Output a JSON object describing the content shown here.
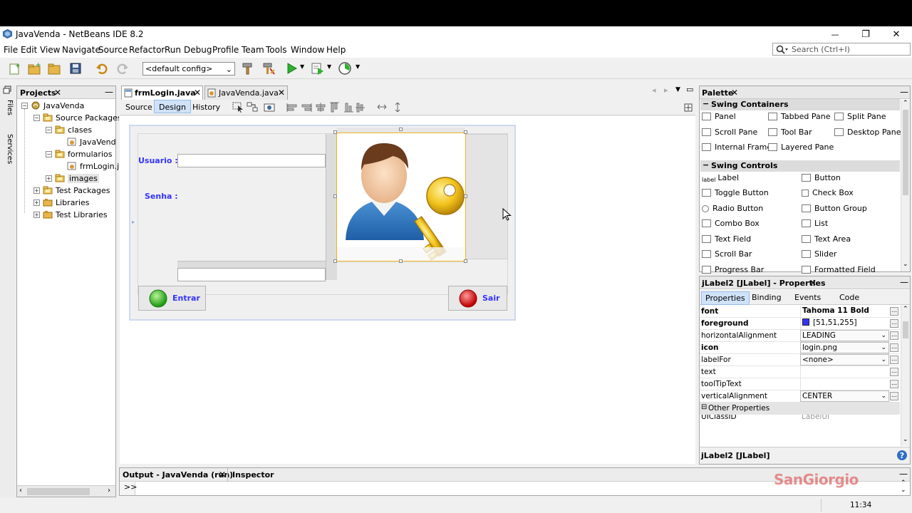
{
  "window": {
    "title": "JavaVenda - NetBeans IDE 8.2",
    "minimize": "—",
    "maximize": "❐",
    "close": "✕"
  },
  "menu": [
    "File",
    "Edit",
    "View",
    "Navigate",
    "Source",
    "Refactor",
    "Run",
    "Debug",
    "Profile",
    "Team",
    "Tools",
    "Window",
    "Help"
  ],
  "search": {
    "placeholder": "Search (Ctrl+I)"
  },
  "toolbar": {
    "config": "<default config>"
  },
  "side_strip": [
    "Files",
    "Services"
  ],
  "projects": {
    "title": "Projects",
    "tree": [
      {
        "label": "JavaVenda",
        "depth": 0,
        "exp": "−"
      },
      {
        "label": "Source Packages",
        "depth": 1,
        "exp": "−"
      },
      {
        "label": "clases",
        "depth": 2,
        "exp": "−"
      },
      {
        "label": "JavaVend",
        "depth": 3,
        "exp": ""
      },
      {
        "label": "formularios",
        "depth": 2,
        "exp": "−"
      },
      {
        "label": "frmLogin.j",
        "depth": 3,
        "exp": ""
      },
      {
        "label": "images",
        "depth": 2,
        "exp": "+"
      },
      {
        "label": "Test Packages",
        "depth": 1,
        "exp": "+"
      },
      {
        "label": "Libraries",
        "depth": 1,
        "exp": "+"
      },
      {
        "label": "Test Libraries",
        "depth": 1,
        "exp": "+"
      }
    ]
  },
  "editor": {
    "tabs": [
      {
        "label": "frmLogin.java",
        "active": true
      },
      {
        "label": "JavaVenda.java",
        "active": false
      }
    ],
    "views": [
      "Source",
      "Design",
      "History"
    ],
    "active_view": "Design"
  },
  "form": {
    "usuario_label": "Usuario :",
    "senha_label": "Senha :",
    "entrar_label": "Entrar",
    "sair_label": "Sair"
  },
  "palette": {
    "title": "Palette",
    "categories": [
      {
        "name": "Swing Containers",
        "items": [
          "Panel",
          "Tabbed Pane",
          "Split Pane",
          "Scroll Pane",
          "Tool Bar",
          "Desktop Pane",
          "Internal Frame",
          "Layered Pane"
        ]
      },
      {
        "name": "Swing Controls",
        "items": [
          "Label",
          "Button",
          "Toggle Button",
          "Check Box",
          "Radio Button",
          "Button Group",
          "Combo Box",
          "List",
          "Text Field",
          "Text Area",
          "Scroll Bar",
          "Slider",
          "Progress Bar",
          "Formatted Field"
        ]
      }
    ],
    "label_icon_text": "label"
  },
  "properties": {
    "title": "jLabel2 [JLabel] - Properties",
    "tabs": [
      "Properties",
      "Binding",
      "Events",
      "Code"
    ],
    "rows": [
      {
        "name": "font",
        "value": "Tahoma 11 Bold",
        "bold": true,
        "dropdown": false
      },
      {
        "name": "foreground",
        "value": "[51,51,255]",
        "bold": true,
        "dropdown": false,
        "swatch": "#3333ff"
      },
      {
        "name": "horizontalAlignment",
        "value": "LEADING",
        "bold": false,
        "dropdown": true
      },
      {
        "name": "icon",
        "value": "login.png",
        "bold": true,
        "dropdown": true
      },
      {
        "name": "labelFor",
        "value": "<none>",
        "bold": false,
        "dropdown": true
      },
      {
        "name": "text",
        "value": "",
        "bold": false,
        "dropdown": false
      },
      {
        "name": "toolTipText",
        "value": "",
        "bold": false,
        "dropdown": false
      },
      {
        "name": "verticalAlignment",
        "value": "CENTER",
        "bold": false,
        "dropdown": true
      }
    ],
    "other_header": "Other Properties",
    "partial_row": {
      "name": "UIClassID",
      "value": "LabelUI"
    },
    "footer": "jLabel2 [JLabel]"
  },
  "output": {
    "tabs": [
      "Output - JavaVenda (run)",
      "Inspector"
    ],
    "prompt": ">>"
  },
  "watermark": "SanGiorgio",
  "clock": "11:34",
  "colors": {
    "label_blue": "#3333ff",
    "selection": "#cfe2f8",
    "accent": "#2e7d32"
  }
}
